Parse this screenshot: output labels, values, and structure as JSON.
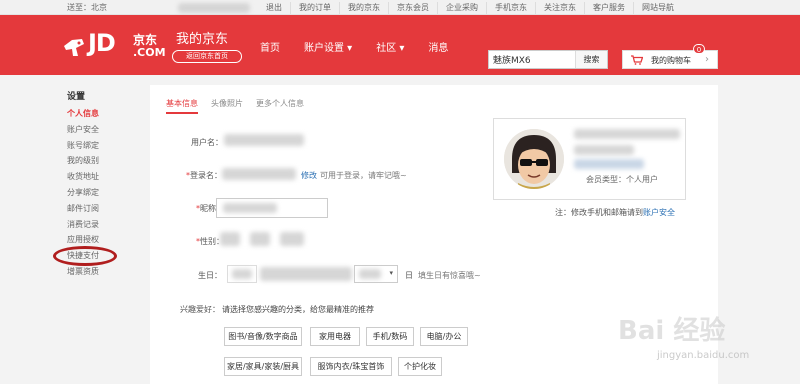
{
  "topbar": {
    "location": "送至：北京",
    "links": [
      "退出",
      "我的订单",
      "我的京东",
      "京东会员",
      "企业采购",
      "手机京东",
      "关注京东",
      "客户服务",
      "网站导航"
    ]
  },
  "header": {
    "logo_jd": "JD",
    "logo_cn": "京东",
    "logo_com": ".COM",
    "my_jd": "我的京东",
    "back_home": "返回京东首页",
    "nav": [
      "首页",
      "账户设置 ▾",
      "社区 ▾",
      "消息"
    ],
    "search_value": "魅族MX6",
    "search_button": "搜索",
    "cart_label": "我的购物车",
    "cart_count": "0"
  },
  "sidebar": {
    "title": "设置",
    "items": [
      "个人信息",
      "账户安全",
      "账号绑定",
      "我的级别",
      "收货地址",
      "分享绑定",
      "邮件订阅",
      "消费记录",
      "应用授权",
      "快捷支付",
      "增票资质"
    ]
  },
  "tabs": [
    "基本信息",
    "头像照片",
    "更多个人信息"
  ],
  "form": {
    "username_label": "用户名：",
    "login_name_label": "登录名：",
    "modify_link": "修改",
    "login_hint": "可用于登录，请牢记哦~",
    "nickname_label": "昵称：",
    "gender_label": "性别：",
    "birthday_label": "生日：",
    "birthday_suffix": "日",
    "birthday_hint": "填生日有惊喜哦~",
    "interests_label": "兴趣爱好：",
    "interests_hint": "请选择您感兴趣的分类，给您最精准的推荐",
    "tags": [
      [
        "图书/音像/数字商品",
        "家用电器",
        "手机/数码",
        "电脑/办公"
      ],
      [
        "家居/家具/家装/厨具",
        "服饰内衣/珠宝首饰",
        "个护化妆"
      ]
    ]
  },
  "profile": {
    "member_type": "会员类型：个人用户"
  },
  "notice": {
    "text": "注：修改手机和邮箱请到",
    "link": "账户安全"
  },
  "watermark": {
    "brand": "Bai 经验",
    "url": "jingyan.baidu.com"
  },
  "colors": {
    "brand_red": "#e4393c",
    "link_blue": "#2a6fb3",
    "circle": "#b01e1e"
  }
}
